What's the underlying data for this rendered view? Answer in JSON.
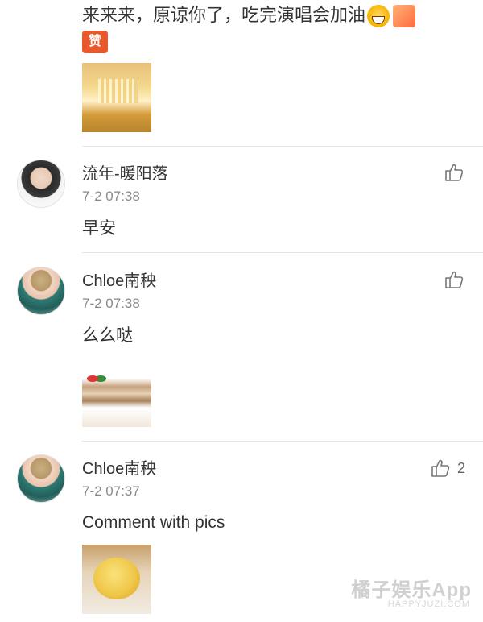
{
  "top_comment": {
    "text": "来来来，原谅你了，吃完演唱会加油",
    "emojis": [
      "grinning-face-icon",
      "clapping-hands-icon",
      "zan-sticker-icon"
    ],
    "zan_text": "赞"
  },
  "comments": [
    {
      "name": "流年-暖阳落",
      "time": "7-2 07:38",
      "text": "早安",
      "likes": ""
    },
    {
      "name": "Chloe南秧",
      "time": "7-2 07:38",
      "text": "么么哒",
      "likes": ""
    },
    {
      "name": "Chloe南秧",
      "time": "7-2 07:37",
      "text": "Comment with pics",
      "likes": "2"
    }
  ],
  "watermark": {
    "text": "橘子娱乐App",
    "sub": "HAPPYJUZI.COM"
  }
}
